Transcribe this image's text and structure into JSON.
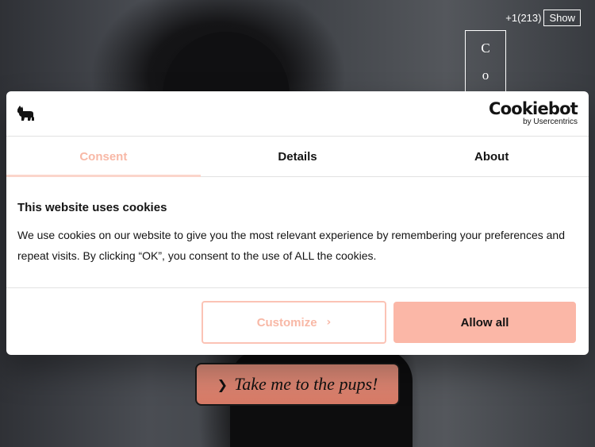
{
  "top_bar": {
    "phone": "+1(213)",
    "show_label": "Show"
  },
  "side_box": {
    "letters": [
      "C",
      "o"
    ]
  },
  "hero": {
    "cta_label": "Take me to the pups!"
  },
  "cookie_dialog": {
    "brand_name": "Cookiebot",
    "brand_sub": "by Usercentrics",
    "tabs": [
      {
        "label": "Consent",
        "active": true
      },
      {
        "label": "Details",
        "active": false
      },
      {
        "label": "About",
        "active": false
      }
    ],
    "title": "This website uses cookies",
    "body": "We use cookies on our website to give you the most relevant experience by remembering your preferences and repeat visits. By clicking “OK”, you consent to the use of ALL the cookies.",
    "customize_label": "Customize",
    "allow_label": "Allow all"
  },
  "colors": {
    "accent": "#fbb7a7",
    "accent_text": "#f8b8a6",
    "cta_button": "#d77a66"
  },
  "icons": {
    "dog_logo": "dog-icon",
    "customize_chevron": "chevron-right-icon",
    "cta_chevron": "chevron-right-icon"
  }
}
